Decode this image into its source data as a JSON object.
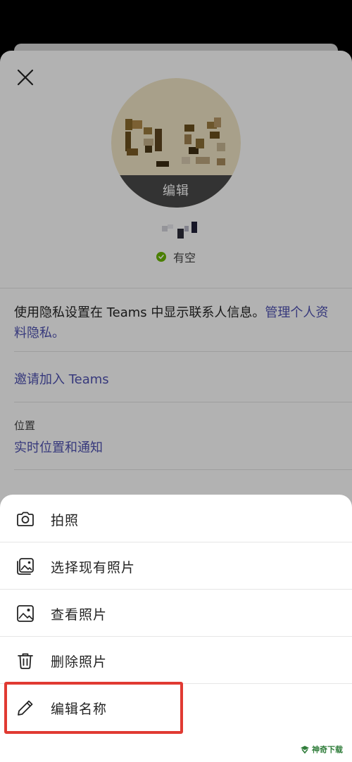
{
  "profile": {
    "close_icon": "close-icon",
    "avatar_edit_label": "编辑",
    "status": {
      "text": "有空",
      "color": "#6bb700"
    }
  },
  "info": {
    "privacy_text": "使用隐私设置在 Teams 中显示联系人信息。",
    "privacy_link": "管理个人资料隐私。",
    "invite_link": "邀请加入 Teams",
    "location_label": "位置",
    "location_link": "实时位置和通知"
  },
  "action_sheet": {
    "items": [
      {
        "label": "拍照",
        "icon": "camera-icon"
      },
      {
        "label": "选择现有照片",
        "icon": "gallery-icon"
      },
      {
        "label": "查看照片",
        "icon": "image-icon"
      },
      {
        "label": "删除照片",
        "icon": "trash-icon"
      },
      {
        "label": "编辑名称",
        "icon": "pencil-icon"
      }
    ]
  },
  "watermark": {
    "text": "神奇下载"
  },
  "colors": {
    "link": "#4f52b2",
    "highlight": "#e03a32",
    "available": "#6bb700"
  }
}
